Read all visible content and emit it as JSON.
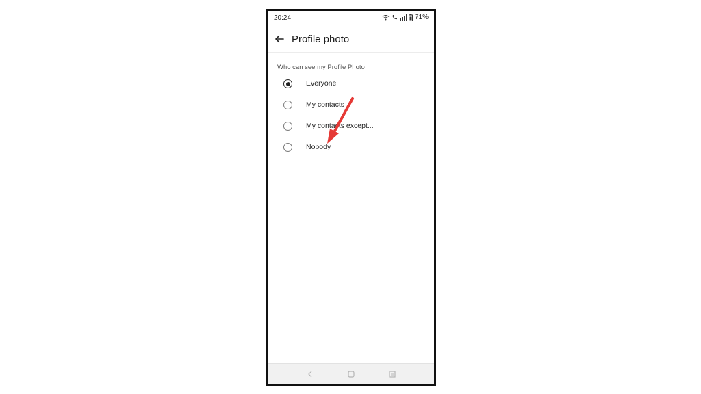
{
  "status_bar": {
    "time": "20:24",
    "battery": "71%",
    "icons": [
      "wifi-icon",
      "volte-icon",
      "signal-icon",
      "battery-icon"
    ]
  },
  "app_bar": {
    "back_icon": "arrow-left-icon",
    "title": "Profile photo"
  },
  "section": {
    "label": "Who can see my Profile Photo",
    "options": [
      {
        "label": "Everyone",
        "selected": true
      },
      {
        "label": "My contacts",
        "selected": false
      },
      {
        "label": "My contacts except...",
        "selected": false
      },
      {
        "label": "Nobody",
        "selected": false
      }
    ]
  },
  "nav_bar": {
    "icons": [
      "back-nav-icon",
      "home-nav-icon",
      "recents-nav-icon"
    ]
  },
  "annotation": {
    "arrow_color": "#e53935",
    "points_to": "Nobody"
  },
  "colors": {
    "frame": "#111111",
    "text": "#222222",
    "annotation": "#e53935"
  }
}
